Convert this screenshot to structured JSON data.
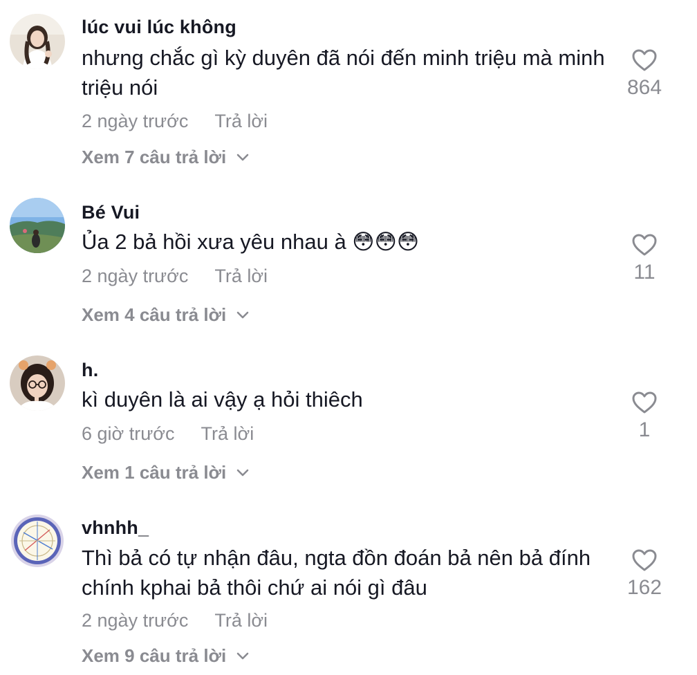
{
  "comments": [
    {
      "username": "lúc vui lúc không",
      "text": "nhưng chắc gì kỳ duyên đã nói đến minh triệu mà minh triệu nói",
      "time": "2 ngày trước",
      "reply_label": "Trả lời",
      "view_replies": "Xem 7 câu trả lời",
      "likes": "864"
    },
    {
      "username": "Bé Vui",
      "text": "Ủa 2 bả hồi xưa yêu nhau à 😳😳😳",
      "time": "2 ngày trước",
      "reply_label": "Trả lời",
      "view_replies": "Xem 4 câu trả lời",
      "likes": "11"
    },
    {
      "username": "h.",
      "text": "kì duyên là ai vậy ạ hỏi thiêch",
      "time": "6 giờ trước",
      "reply_label": "Trả lời",
      "view_replies": "Xem 1 câu trả lời",
      "likes": "1"
    },
    {
      "username": "vhnhh_",
      "text": "Thì bả có tự nhận đâu, ngta đồn đoán bả nên bả đính chính kphai bả thôi chứ ai nói gì đâu",
      "time": "2 ngày trước",
      "reply_label": "Trả lời",
      "view_replies": "Xem 9 câu trả lời",
      "likes": "162"
    }
  ],
  "icons": {
    "like": "heart-outline-icon",
    "expand": "chevron-down-icon"
  },
  "colors": {
    "primary_text": "#161823",
    "secondary_text": "#8a8b91",
    "background": "#ffffff"
  }
}
